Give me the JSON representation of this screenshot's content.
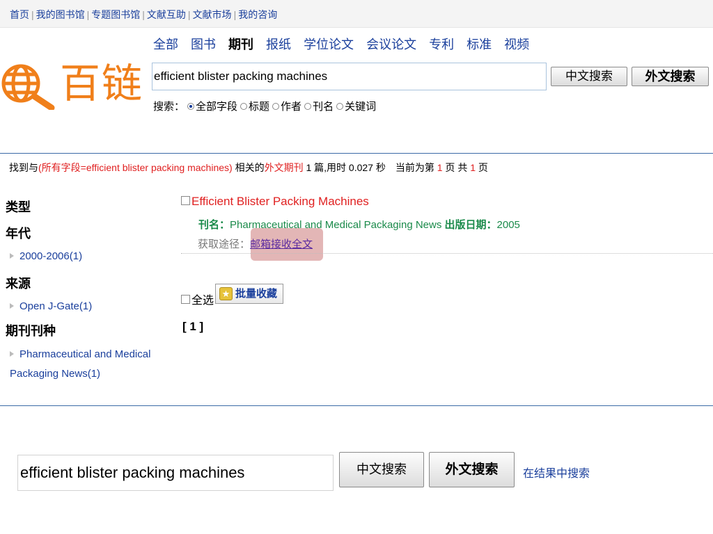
{
  "topnav": {
    "links": [
      "首页",
      "我的图书馆",
      "专题图书馆",
      "文献互助",
      "文献市场",
      "我的咨询"
    ]
  },
  "logo": {
    "text": "百链"
  },
  "categories": [
    {
      "label": "全部",
      "active": false
    },
    {
      "label": "图书",
      "active": false
    },
    {
      "label": "期刊",
      "active": true
    },
    {
      "label": "报纸",
      "active": false
    },
    {
      "label": "学位论文",
      "active": false
    },
    {
      "label": "会议论文",
      "active": false
    },
    {
      "label": "专利",
      "active": false
    },
    {
      "label": "标准",
      "active": false
    },
    {
      "label": "视频",
      "active": false
    }
  ],
  "search": {
    "query": "efficient blister packing machines",
    "btn_cn": "中文搜索",
    "btn_en": "外文搜索",
    "fields_label": "搜索：",
    "fields": [
      "全部字段",
      "标题",
      "作者",
      "刊名",
      "关键词"
    ]
  },
  "summary": {
    "p1": "找到与",
    "query_expr": "(所有字段=efficient blister packing machines)",
    "p2": " 相关的",
    "type": "外文期刊",
    "count": "1",
    "p3": " 篇,用时 0.027 秒　当前为第 ",
    "page": "1",
    "p4": " 页 共 ",
    "total": "1",
    "p5": " 页"
  },
  "sidebar": {
    "type_h": "类型",
    "year_h": "年代",
    "year_item": "2000-2006(1)",
    "source_h": "来源",
    "source_item": "Open J-Gate(1)",
    "journal_h": "期刊刊种",
    "journal_item_1": "Pharmaceutical and Medical",
    "journal_item_2": "Packaging News(1)"
  },
  "result": {
    "title": "Efficient Blister Packing Machines",
    "journal_label": "刊名：",
    "journal": "Pharmaceutical and Medical Packaging News",
    "date_label": "出版日期：",
    "date": "2005",
    "access_label": "获取途径：",
    "access_link": "邮箱接收全文"
  },
  "actions": {
    "select_all": "全选",
    "batch_save": "批量收藏",
    "pager": "[ 1 ]"
  },
  "bottom": {
    "query": "efficient blister packing machines",
    "btn_cn": "中文搜索",
    "btn_en": "外文搜索",
    "in_results": "在结果中搜索"
  },
  "colors": {
    "link_blue": "#1a3f9c",
    "red": "#e02020",
    "green": "#1a8a4a",
    "orange": "#f07f1a"
  },
  "icons": [
    "globe-magnifier-icon",
    "radio-icon",
    "checkbox-icon",
    "batch-save-icon",
    "triangle-icon"
  ]
}
